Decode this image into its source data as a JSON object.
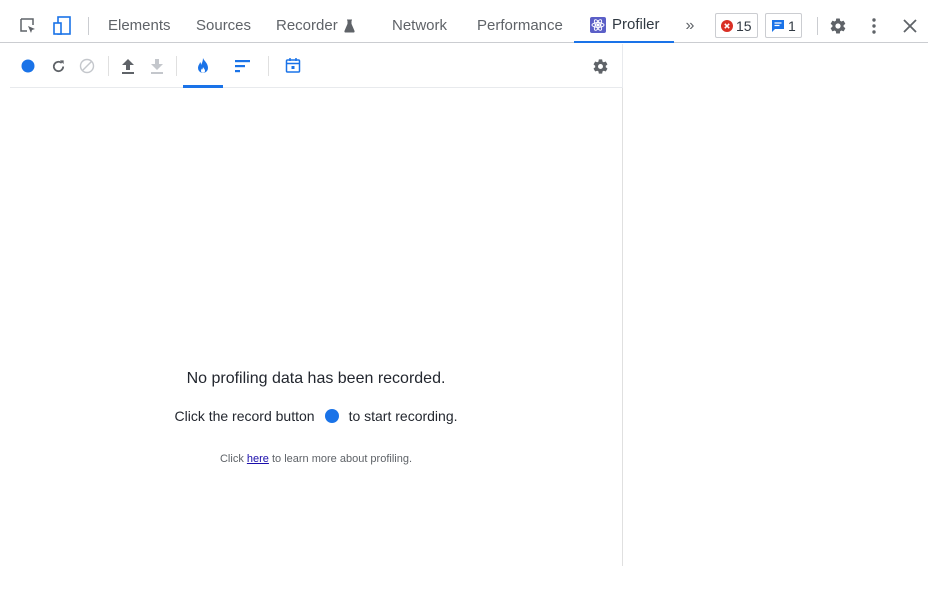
{
  "devtools": {
    "tabs": [
      {
        "label": "Elements"
      },
      {
        "label": "Sources"
      },
      {
        "label": "Recorder"
      },
      {
        "label": "Network"
      },
      {
        "label": "Performance"
      },
      {
        "label": "Profiler"
      }
    ],
    "active_tab": "Profiler",
    "more_tabs_icon": "chevron-double-right-icon",
    "errors_count": "15",
    "messages_count": "1",
    "colors": {
      "accent": "#1a73e8",
      "error": "#d93025",
      "border": "#cbcdd1"
    }
  },
  "profiler": {
    "toolbar_icons": [
      "record-icon",
      "reload-icon",
      "clear-icon",
      "load-profile-icon",
      "save-profile-icon",
      "flamegraph-icon",
      "ranked-icon",
      "timeline-icon",
      "settings-icon"
    ],
    "empty": {
      "title": "No profiling data has been recorded.",
      "line_prefix": "Click the record button",
      "line_suffix": "to start recording.",
      "small_prefix": "Click",
      "small_link": "here",
      "small_suffix": "to learn more about profiling."
    }
  }
}
